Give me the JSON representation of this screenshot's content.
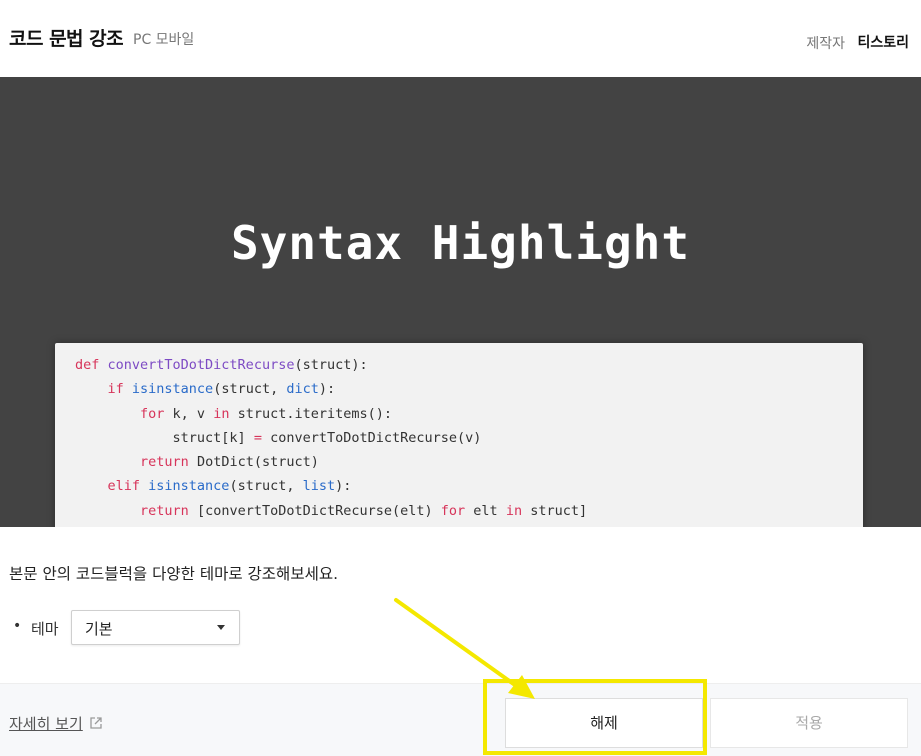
{
  "header": {
    "title": "코드 문법 강조",
    "platform": "PC 모바일",
    "maker_label": "제작자",
    "maker_name": "티스토리"
  },
  "preview": {
    "title": "Syntax Highlight",
    "code_lines": [
      {
        "tokens": [
          {
            "t": "def ",
            "c": "kw"
          },
          {
            "t": "convertToDotDictRecurse",
            "c": "fn"
          },
          {
            "t": "(struct):",
            "c": ""
          }
        ]
      },
      {
        "tokens": [
          {
            "t": "    ",
            "c": ""
          },
          {
            "t": "if ",
            "c": "kw"
          },
          {
            "t": "isinstance",
            "c": "bi"
          },
          {
            "t": "(struct, ",
            "c": ""
          },
          {
            "t": "dict",
            "c": "bi"
          },
          {
            "t": "):",
            "c": ""
          }
        ]
      },
      {
        "tokens": [
          {
            "t": "        ",
            "c": ""
          },
          {
            "t": "for ",
            "c": "kw"
          },
          {
            "t": "k, v ",
            "c": ""
          },
          {
            "t": "in ",
            "c": "kw"
          },
          {
            "t": "struct.iteritems():",
            "c": ""
          }
        ]
      },
      {
        "tokens": [
          {
            "t": "            struct[k] ",
            "c": ""
          },
          {
            "t": "= ",
            "c": "kw"
          },
          {
            "t": "convertToDotDictRecurse(v)",
            "c": ""
          }
        ]
      },
      {
        "tokens": [
          {
            "t": "        ",
            "c": ""
          },
          {
            "t": "return ",
            "c": "kw"
          },
          {
            "t": "DotDict(struct)",
            "c": ""
          }
        ]
      },
      {
        "tokens": [
          {
            "t": "    ",
            "c": ""
          },
          {
            "t": "elif ",
            "c": "kw"
          },
          {
            "t": "isinstance",
            "c": "bi"
          },
          {
            "t": "(struct, ",
            "c": ""
          },
          {
            "t": "list",
            "c": "bi"
          },
          {
            "t": "):",
            "c": ""
          }
        ]
      },
      {
        "tokens": [
          {
            "t": "        ",
            "c": ""
          },
          {
            "t": "return ",
            "c": "kw"
          },
          {
            "t": "[convertToDotDictRecurse(elt) ",
            "c": ""
          },
          {
            "t": "for ",
            "c": "kw"
          },
          {
            "t": "elt ",
            "c": ""
          },
          {
            "t": "in ",
            "c": "kw"
          },
          {
            "t": "struct]",
            "c": ""
          }
        ]
      }
    ]
  },
  "body": {
    "description": "본문 안의 코드블럭을 다양한 테마로 강조해보세요.",
    "theme_bullet": "•",
    "theme_label": "테마",
    "theme_value": "기본"
  },
  "footer": {
    "more_label": "자세히 보기",
    "release_label": "해제",
    "apply_label": "적용"
  },
  "colors": {
    "hero_bg": "#434343",
    "keyword": "#d7345a",
    "function": "#7d4bc4",
    "builtin": "#2a6bc9",
    "highlight": "#f4e800"
  },
  "icons": {
    "external": "external-link-icon",
    "select_caret": "caret-down-icon",
    "annotation_arrow": "arrow-annotation-icon"
  }
}
